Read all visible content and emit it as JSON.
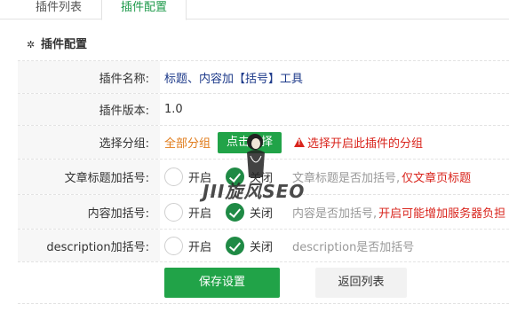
{
  "tabs": [
    {
      "label": "插件列表",
      "active": false
    },
    {
      "label": "插件配置",
      "active": true
    }
  ],
  "panel": {
    "title": "插件配置",
    "title_icon": "gear-icon"
  },
  "fields": {
    "name": {
      "label": "插件名称:",
      "value": "标题、内容加【括号】工具"
    },
    "version": {
      "label": "插件版本:",
      "value": "1.0"
    },
    "group": {
      "label": "选择分组:",
      "value": "全部分组",
      "button": "点击选择",
      "warning": "选择开启此插件的分组"
    },
    "title_brackets": {
      "label": "文章标题加括号:",
      "on_label": "开启",
      "off_label": "关闭",
      "selected": "关闭",
      "hint": "文章标题是否加括号,",
      "hint_red": "仅文章页标题"
    },
    "content_brackets": {
      "label": "内容加括号:",
      "on_label": "开启",
      "off_label": "关闭",
      "selected": "关闭",
      "hint": "内容是否加括号,",
      "hint_red": "开启可能增加服务器负担"
    },
    "description_brackets": {
      "label": "description加括号:",
      "on_label": "开启",
      "off_label": "关闭",
      "selected": "关闭",
      "hint": "description是否加括号"
    }
  },
  "actions": {
    "save": "保存设置",
    "back": "返回列表"
  },
  "watermark": {
    "text": "JII旋风SEO"
  },
  "colors": {
    "accent_green": "#21a348",
    "link_blue": "#1d3a8a",
    "orange": "#e07b1a",
    "warning_red": "#d9241c"
  }
}
